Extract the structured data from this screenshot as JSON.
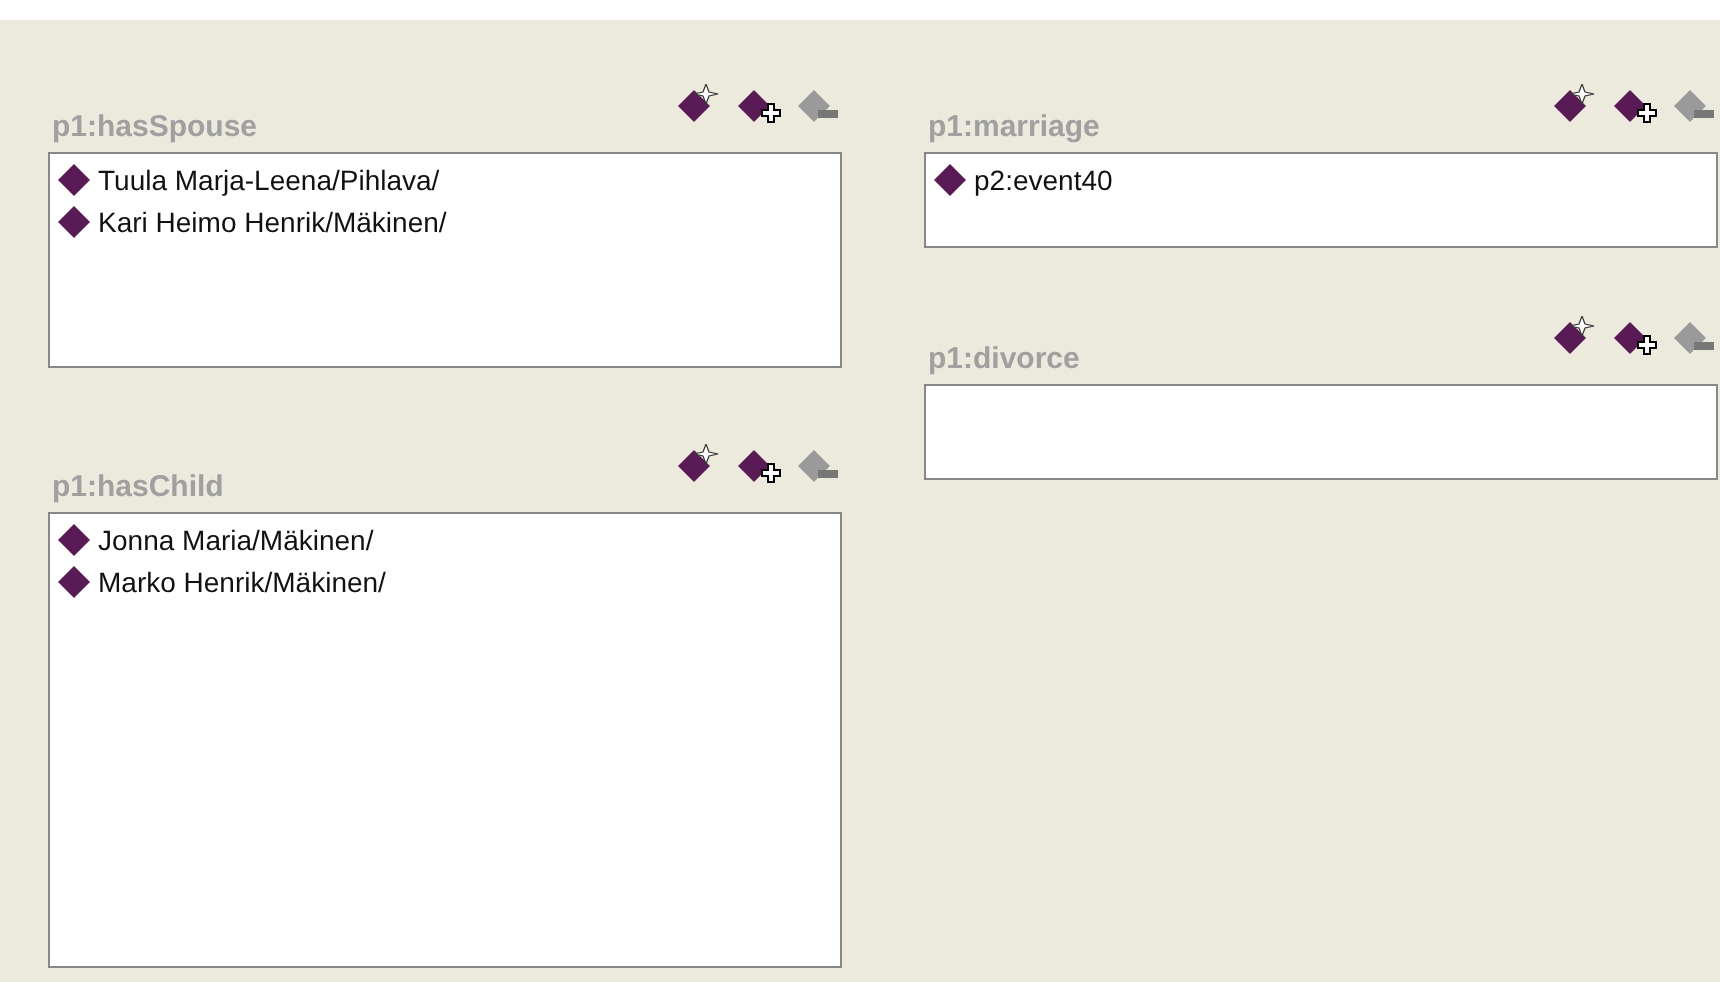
{
  "columns": [
    {
      "slots": [
        {
          "label": "p1:hasSpouse",
          "remove_disabled": true,
          "values": [
            "Tuula Marja-Leena/Pihlava/",
            "Kari Heimo Henrik/Mäkinen/"
          ]
        },
        {
          "label": "p1:hasChild",
          "remove_disabled": true,
          "values": [
            "Jonna Maria/Mäkinen/",
            "Marko Henrik/Mäkinen/"
          ]
        }
      ]
    },
    {
      "slots": [
        {
          "label": "p1:marriage",
          "remove_disabled": true,
          "values": [
            "p2:event40"
          ]
        },
        {
          "label": "p1:divorce",
          "remove_disabled": true
        }
      ]
    }
  ]
}
